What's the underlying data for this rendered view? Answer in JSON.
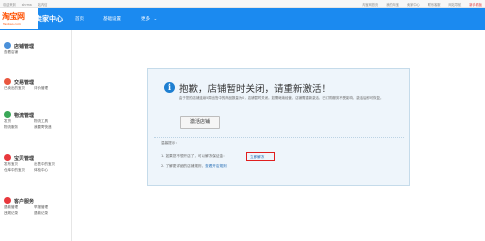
{
  "topbar": {
    "left": [
      "欢迎来到",
      "shrma",
      "站内信"
    ],
    "right": [
      "淘宝网首页",
      "我的淘宝",
      "卖家中心",
      "联系客服",
      "网站导航"
    ],
    "warn": "新手看板"
  },
  "header": {
    "logo": "淘宝网",
    "logo_sub": "Taobao.com",
    "title": "卖家中心",
    "nav": [
      "首页",
      "基础设置",
      "更多"
    ]
  },
  "sidebar": {
    "sections": [
      {
        "title": "店铺管理",
        "items": [
          [
            "查看店铺",
            ""
          ]
        ]
      },
      {
        "title": "交易管理",
        "items": [
          [
            "已卖出的宝贝",
            "评价管理"
          ]
        ]
      },
      {
        "title": "物流管理",
        "items": [
          [
            "发货",
            "物流工具"
          ],
          [
            "物流服务",
            "我要寄快递"
          ]
        ]
      },
      {
        "title": "宝贝管理",
        "items": [
          [
            "发布宝贝",
            "出售中的宝贝"
          ],
          [
            "仓库中的宝贝",
            "体检中心"
          ]
        ]
      },
      {
        "title": "客户服务",
        "items": [
          [
            "退款管理",
            "举报管理"
          ],
          [
            "违规记录",
            "退款记录"
          ]
        ]
      }
    ]
  },
  "notice": {
    "headline": "抱歉，店铺暂时关闭，请重新激活！",
    "desc": "由于您的店铺连续5周出售中的商品数量为0，店铺暂时关闭。如需继续经营，店铺需重新激活，已订购服务不受影响，激活后即可恢复。",
    "activate": "激活店铺",
    "hint_title": "温馨提示：",
    "hint1_pre": "1. 如果您不想开店了，可以解冻保证金：",
    "hint1_link": "立即解冻",
    "hint2_pre": "2. 了解更详细的店铺规则，",
    "hint2_link": "查看开店规则"
  },
  "colors": {
    "nav": "#1b8af0",
    "notice_bg": "#eef5fb",
    "highlight": "#e01e1e"
  }
}
